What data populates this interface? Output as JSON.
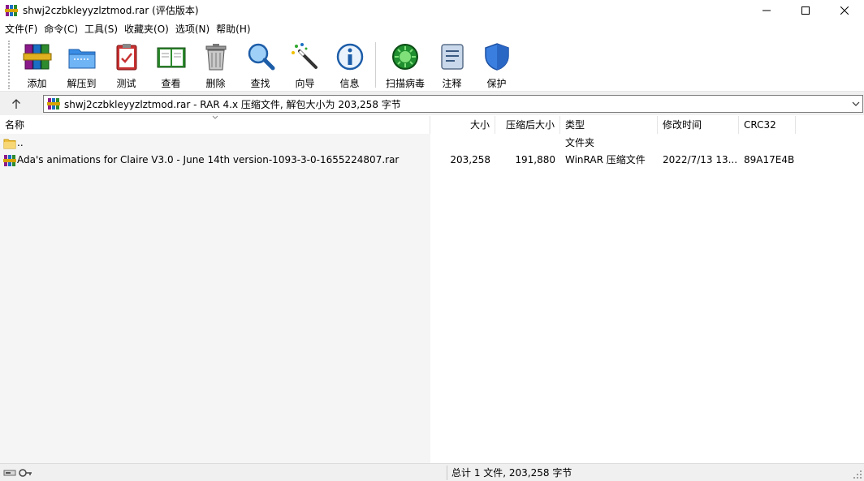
{
  "window": {
    "title": "shwj2czbkleyyzlztmod.rar (评估版本)"
  },
  "menu": [
    {
      "label": "文件(F)"
    },
    {
      "label": "命令(C)"
    },
    {
      "label": "工具(S)"
    },
    {
      "label": "收藏夹(O)"
    },
    {
      "label": "选项(N)"
    },
    {
      "label": "帮助(H)"
    }
  ],
  "toolbar": {
    "add": "添加",
    "extract": "解压到",
    "test": "测试",
    "view": "查看",
    "delete": "删除",
    "find": "查找",
    "wizard": "向导",
    "info": "信息",
    "virus_scan": "扫描病毒",
    "comment": "注释",
    "protect": "保护"
  },
  "address": {
    "text": "shwj2czbkleyyzlztmod.rar - RAR 4.x 压缩文件, 解包大小为 203,258 字节"
  },
  "columns": {
    "name": "名称",
    "size": "大小",
    "packed": "压缩后大小",
    "type": "类型",
    "modified": "修改时间",
    "crc": "CRC32"
  },
  "rows": [
    {
      "name": "..",
      "size": "",
      "packed": "",
      "type": "文件夹",
      "modified": "",
      "crc": ""
    },
    {
      "name": "Ada's animations for Claire V3.0 - June 14th version-1093-3-0-1655224807.rar",
      "size": "203,258",
      "packed": "191,880",
      "type": "WinRAR 压缩文件",
      "modified": "2022/7/13 13...",
      "crc": "89A17E4B"
    }
  ],
  "status": {
    "text": "总计 1 文件, 203,258 字节"
  },
  "icons": {
    "app": "winrar-books-icon",
    "folder": "folder-icon",
    "archive": "rar-archive-icon"
  }
}
